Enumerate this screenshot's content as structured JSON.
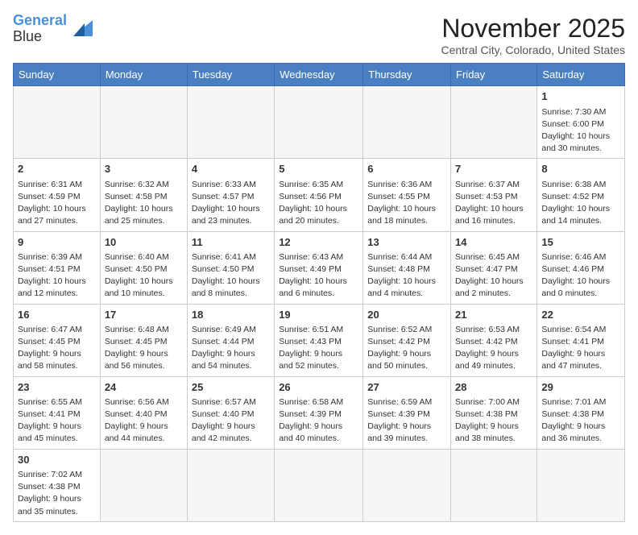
{
  "header": {
    "logo_line1": "General",
    "logo_line2": "Blue",
    "month_title": "November 2025",
    "subtitle": "Central City, Colorado, United States"
  },
  "days_of_week": [
    "Sunday",
    "Monday",
    "Tuesday",
    "Wednesday",
    "Thursday",
    "Friday",
    "Saturday"
  ],
  "weeks": [
    [
      {
        "num": "",
        "info": ""
      },
      {
        "num": "",
        "info": ""
      },
      {
        "num": "",
        "info": ""
      },
      {
        "num": "",
        "info": ""
      },
      {
        "num": "",
        "info": ""
      },
      {
        "num": "",
        "info": ""
      },
      {
        "num": "1",
        "info": "Sunrise: 7:30 AM\nSunset: 6:00 PM\nDaylight: 10 hours\nand 30 minutes."
      }
    ],
    [
      {
        "num": "2",
        "info": "Sunrise: 6:31 AM\nSunset: 4:59 PM\nDaylight: 10 hours\nand 27 minutes."
      },
      {
        "num": "3",
        "info": "Sunrise: 6:32 AM\nSunset: 4:58 PM\nDaylight: 10 hours\nand 25 minutes."
      },
      {
        "num": "4",
        "info": "Sunrise: 6:33 AM\nSunset: 4:57 PM\nDaylight: 10 hours\nand 23 minutes."
      },
      {
        "num": "5",
        "info": "Sunrise: 6:35 AM\nSunset: 4:56 PM\nDaylight: 10 hours\nand 20 minutes."
      },
      {
        "num": "6",
        "info": "Sunrise: 6:36 AM\nSunset: 4:55 PM\nDaylight: 10 hours\nand 18 minutes."
      },
      {
        "num": "7",
        "info": "Sunrise: 6:37 AM\nSunset: 4:53 PM\nDaylight: 10 hours\nand 16 minutes."
      },
      {
        "num": "8",
        "info": "Sunrise: 6:38 AM\nSunset: 4:52 PM\nDaylight: 10 hours\nand 14 minutes."
      }
    ],
    [
      {
        "num": "9",
        "info": "Sunrise: 6:39 AM\nSunset: 4:51 PM\nDaylight: 10 hours\nand 12 minutes."
      },
      {
        "num": "10",
        "info": "Sunrise: 6:40 AM\nSunset: 4:50 PM\nDaylight: 10 hours\nand 10 minutes."
      },
      {
        "num": "11",
        "info": "Sunrise: 6:41 AM\nSunset: 4:50 PM\nDaylight: 10 hours\nand 8 minutes."
      },
      {
        "num": "12",
        "info": "Sunrise: 6:43 AM\nSunset: 4:49 PM\nDaylight: 10 hours\nand 6 minutes."
      },
      {
        "num": "13",
        "info": "Sunrise: 6:44 AM\nSunset: 4:48 PM\nDaylight: 10 hours\nand 4 minutes."
      },
      {
        "num": "14",
        "info": "Sunrise: 6:45 AM\nSunset: 4:47 PM\nDaylight: 10 hours\nand 2 minutes."
      },
      {
        "num": "15",
        "info": "Sunrise: 6:46 AM\nSunset: 4:46 PM\nDaylight: 10 hours\nand 0 minutes."
      }
    ],
    [
      {
        "num": "16",
        "info": "Sunrise: 6:47 AM\nSunset: 4:45 PM\nDaylight: 9 hours\nand 58 minutes."
      },
      {
        "num": "17",
        "info": "Sunrise: 6:48 AM\nSunset: 4:45 PM\nDaylight: 9 hours\nand 56 minutes."
      },
      {
        "num": "18",
        "info": "Sunrise: 6:49 AM\nSunset: 4:44 PM\nDaylight: 9 hours\nand 54 minutes."
      },
      {
        "num": "19",
        "info": "Sunrise: 6:51 AM\nSunset: 4:43 PM\nDaylight: 9 hours\nand 52 minutes."
      },
      {
        "num": "20",
        "info": "Sunrise: 6:52 AM\nSunset: 4:42 PM\nDaylight: 9 hours\nand 50 minutes."
      },
      {
        "num": "21",
        "info": "Sunrise: 6:53 AM\nSunset: 4:42 PM\nDaylight: 9 hours\nand 49 minutes."
      },
      {
        "num": "22",
        "info": "Sunrise: 6:54 AM\nSunset: 4:41 PM\nDaylight: 9 hours\nand 47 minutes."
      }
    ],
    [
      {
        "num": "23",
        "info": "Sunrise: 6:55 AM\nSunset: 4:41 PM\nDaylight: 9 hours\nand 45 minutes."
      },
      {
        "num": "24",
        "info": "Sunrise: 6:56 AM\nSunset: 4:40 PM\nDaylight: 9 hours\nand 44 minutes."
      },
      {
        "num": "25",
        "info": "Sunrise: 6:57 AM\nSunset: 4:40 PM\nDaylight: 9 hours\nand 42 minutes."
      },
      {
        "num": "26",
        "info": "Sunrise: 6:58 AM\nSunset: 4:39 PM\nDaylight: 9 hours\nand 40 minutes."
      },
      {
        "num": "27",
        "info": "Sunrise: 6:59 AM\nSunset: 4:39 PM\nDaylight: 9 hours\nand 39 minutes."
      },
      {
        "num": "28",
        "info": "Sunrise: 7:00 AM\nSunset: 4:38 PM\nDaylight: 9 hours\nand 38 minutes."
      },
      {
        "num": "29",
        "info": "Sunrise: 7:01 AM\nSunset: 4:38 PM\nDaylight: 9 hours\nand 36 minutes."
      }
    ],
    [
      {
        "num": "30",
        "info": "Sunrise: 7:02 AM\nSunset: 4:38 PM\nDaylight: 9 hours\nand 35 minutes."
      },
      {
        "num": "",
        "info": ""
      },
      {
        "num": "",
        "info": ""
      },
      {
        "num": "",
        "info": ""
      },
      {
        "num": "",
        "info": ""
      },
      {
        "num": "",
        "info": ""
      },
      {
        "num": "",
        "info": ""
      }
    ]
  ]
}
